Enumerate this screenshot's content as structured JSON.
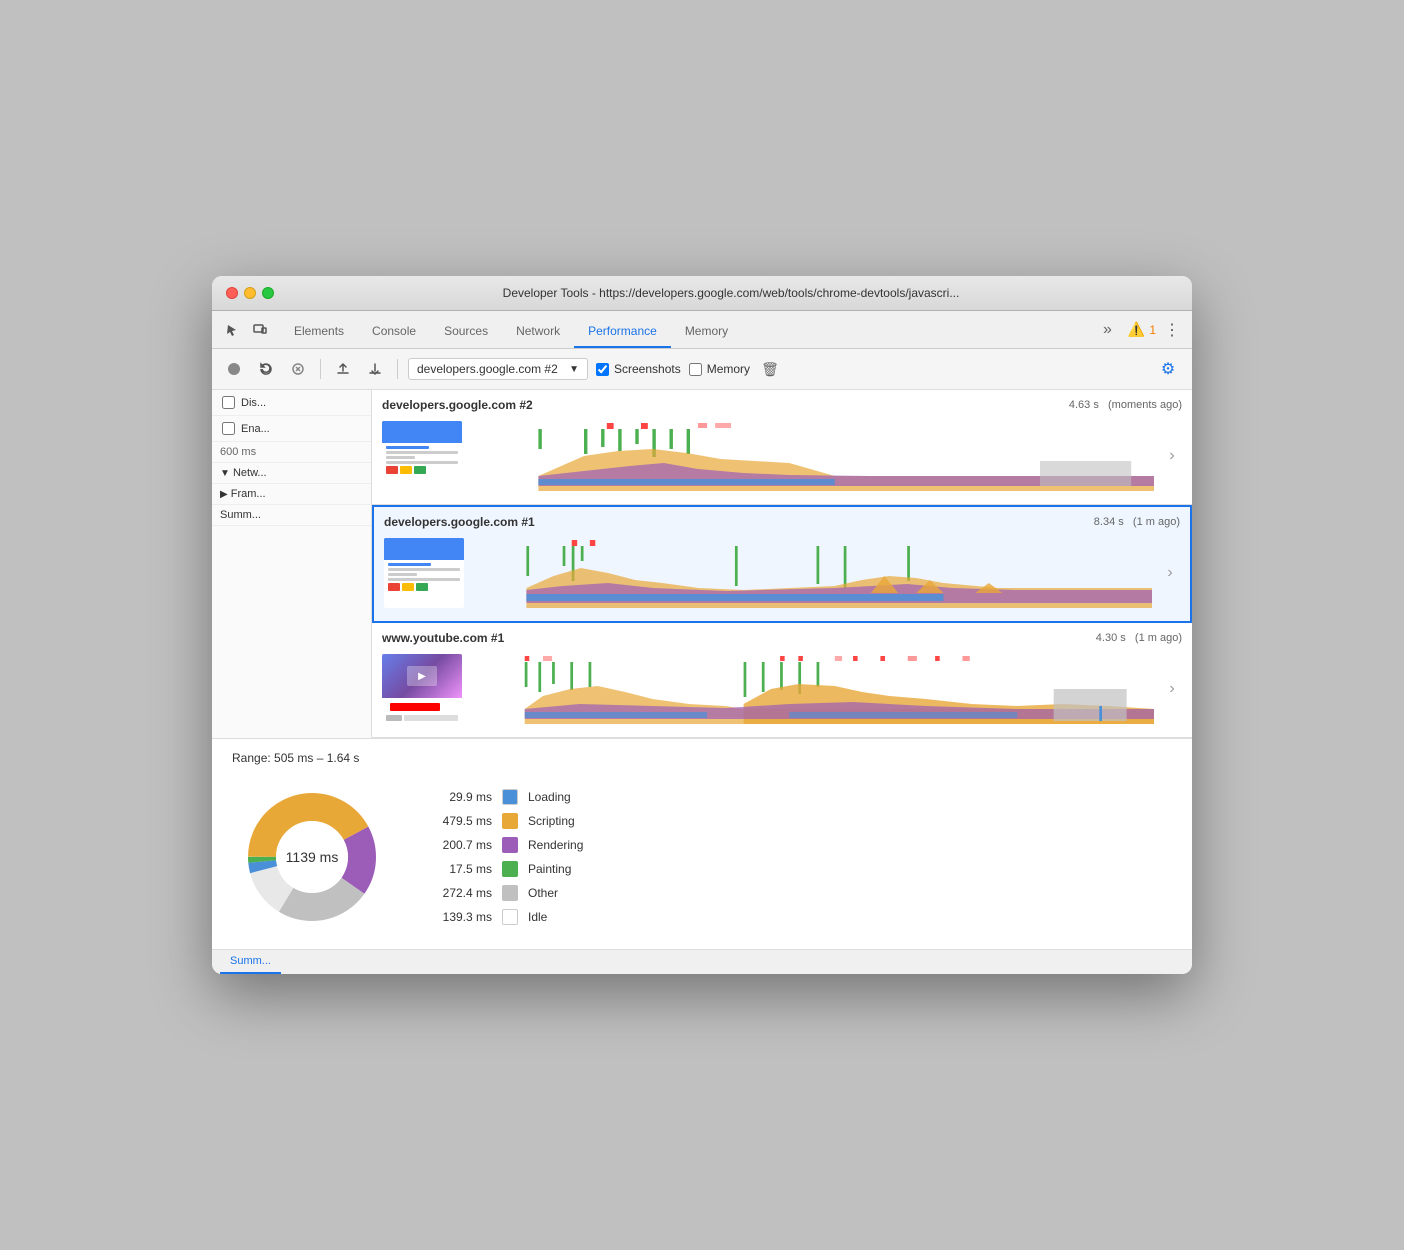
{
  "window": {
    "title": "Developer Tools - https://developers.google.com/web/tools/chrome-devtools/javascri..."
  },
  "tabs": [
    {
      "label": "Elements",
      "active": false
    },
    {
      "label": "Console",
      "active": false
    },
    {
      "label": "Sources",
      "active": false
    },
    {
      "label": "Network",
      "active": false
    },
    {
      "label": "Performance",
      "active": true
    },
    {
      "label": "Memory",
      "active": false
    }
  ],
  "warning": {
    "count": "1"
  },
  "toolbar": {
    "url_value": "developers.google.com #2",
    "screenshots_label": "Screenshots",
    "memory_label": "Memory"
  },
  "sidebar": {
    "disable_label": "Dis...",
    "enable_label": "Ena...",
    "ms_label": "600 ms",
    "network_label": "Netw...",
    "frames_label": "Fram...",
    "summary_label": "Summ..."
  },
  "recordings": [
    {
      "title": "developers.google.com #2",
      "duration": "4.63 s",
      "time_ago": "(moments ago)",
      "selected": false
    },
    {
      "title": "developers.google.com #1",
      "duration": "8.34 s",
      "time_ago": "(1 m ago)",
      "selected": true
    },
    {
      "title": "www.youtube.com #1",
      "duration": "4.30 s",
      "time_ago": "(1 m ago)",
      "selected": false
    }
  ],
  "bottom": {
    "range_label": "Range: 505 ms – 1.64 s",
    "total_ms": "1139 ms",
    "tab_summary": "Summ...",
    "legend": [
      {
        "value": "29.9 ms",
        "name": "Loading",
        "color": "#4a90d9"
      },
      {
        "value": "479.5 ms",
        "name": "Scripting",
        "color": "#e8a838"
      },
      {
        "value": "200.7 ms",
        "name": "Rendering",
        "color": "#9c5db8"
      },
      {
        "value": "17.5 ms",
        "name": "Painting",
        "color": "#4caf50"
      },
      {
        "value": "272.4 ms",
        "name": "Other",
        "color": "#c0c0c0"
      },
      {
        "value": "139.3 ms",
        "name": "Idle",
        "color": "#ffffff"
      }
    ],
    "donut": {
      "segments": [
        {
          "label": "Loading",
          "value": 29.9,
          "color": "#4a90d9",
          "offset": 0
        },
        {
          "label": "Scripting",
          "value": 479.5,
          "color": "#e8a838"
        },
        {
          "label": "Rendering",
          "value": 200.7,
          "color": "#9c5db8"
        },
        {
          "label": "Painting",
          "value": 17.5,
          "color": "#4caf50"
        },
        {
          "label": "Other",
          "value": 272.4,
          "color": "#c0c0c0"
        },
        {
          "label": "Idle",
          "value": 139.3,
          "color": "#e8e8e8"
        }
      ]
    }
  }
}
